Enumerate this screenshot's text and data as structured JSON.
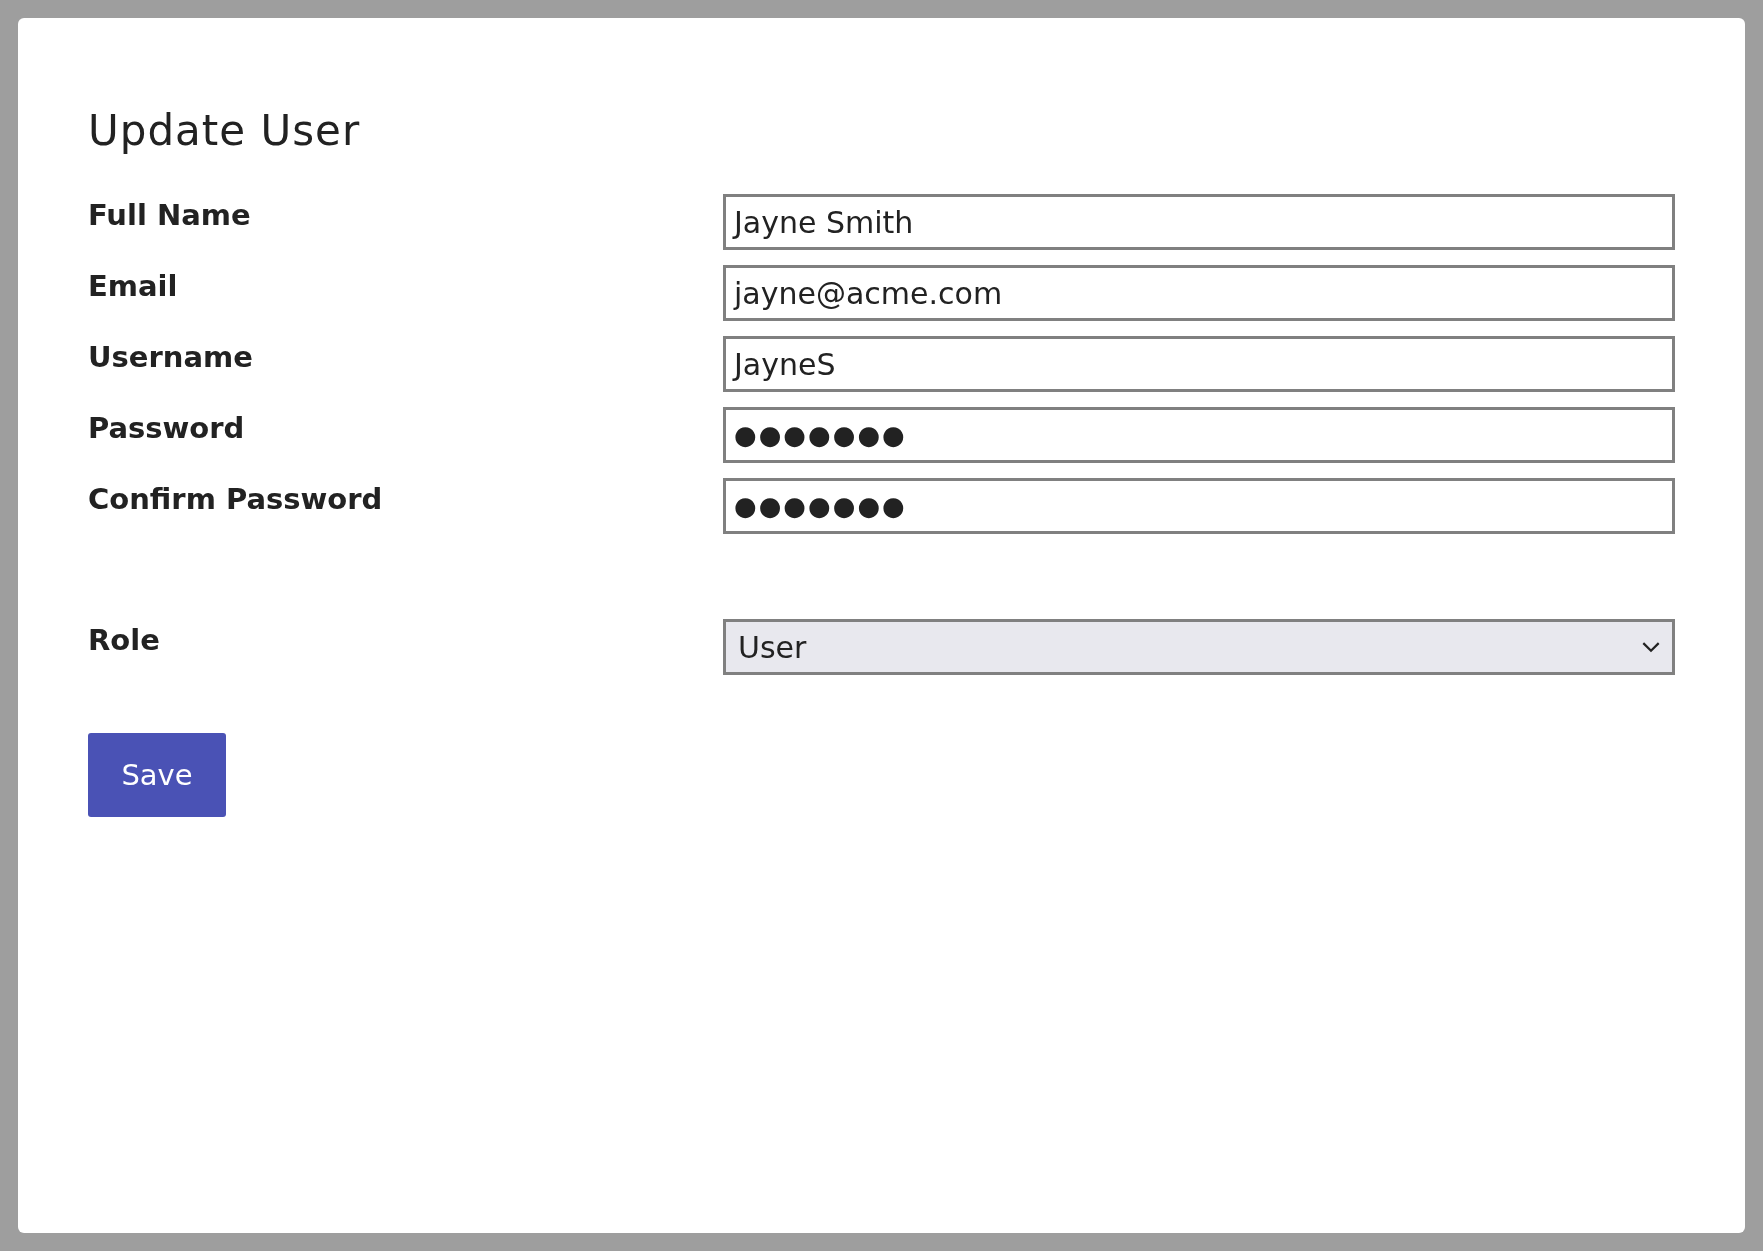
{
  "dialog": {
    "title": "Update User",
    "fields": [
      {
        "kind": "text",
        "label": "Full Name",
        "value": "Jayne Smith"
      },
      {
        "kind": "text",
        "label": "Email",
        "value": "jayne@acme.com"
      },
      {
        "kind": "text",
        "label": "Username",
        "value": "JayneS"
      },
      {
        "kind": "password",
        "label": "Password",
        "value": "●●●●●●●"
      },
      {
        "kind": "password",
        "label": "Confirm Password",
        "value": "●●●●●●●"
      },
      {
        "kind": "select",
        "label": "Role",
        "value": "User"
      }
    ],
    "buttons": [
      "Save"
    ]
  }
}
